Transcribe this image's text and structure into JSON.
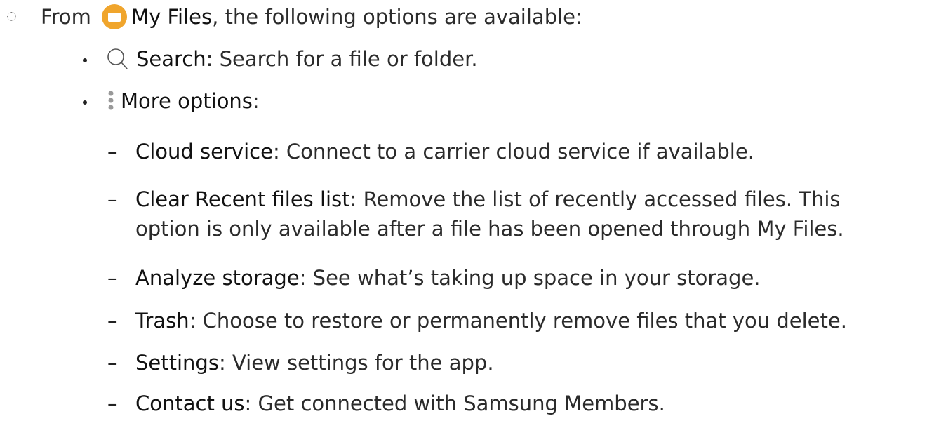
{
  "intro": {
    "prefix": "From ",
    "app_name": "My Files",
    "suffix": ", the following options are available:"
  },
  "options": [
    {
      "icon": "search-icon",
      "term": "Search",
      "desc": ": Search for a file or folder."
    },
    {
      "icon": "more-options-icon",
      "term": "More options",
      "desc": ":"
    }
  ],
  "more_options": [
    {
      "term": "Cloud service",
      "desc": ": Connect to a carrier cloud service if available."
    },
    {
      "term": "Clear Recent files list",
      "desc": ": Remove the list of recently accessed files. This",
      "desc2": "option is only available after a file has been opened through My Files."
    },
    {
      "term": "Analyze storage",
      "desc": ": See what’s taking up space in your storage."
    },
    {
      "term": "Trash",
      "desc": ": Choose to restore or permanently remove files that you delete."
    },
    {
      "term": "Settings",
      "desc": ": View settings for the app."
    },
    {
      "term": "Contact us",
      "desc": ": Get connected with Samsung Members."
    }
  ],
  "dash_glyph": "–",
  "colors": {
    "files_icon": "#f0a52c",
    "text": "#2b2b2b"
  }
}
